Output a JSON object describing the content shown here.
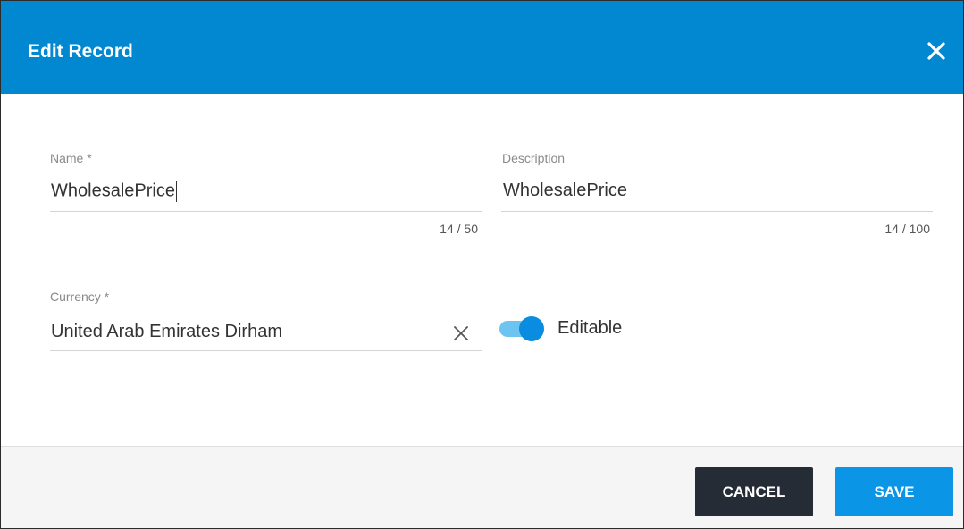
{
  "dialog": {
    "title": "Edit Record"
  },
  "fields": {
    "name": {
      "label": "Name *",
      "value": "WholesalePrice",
      "counter": "14 / 50"
    },
    "description": {
      "label": "Description",
      "value": "WholesalePrice",
      "counter": "14 / 100"
    },
    "currency": {
      "label": "Currency *",
      "value": "United Arab Emirates Dirham"
    },
    "editable": {
      "label": "Editable",
      "checked": true
    }
  },
  "footer": {
    "cancel_label": "CANCEL",
    "save_label": "SAVE"
  },
  "colors": {
    "header": "#0288d1",
    "save_button": "#0b95e6",
    "cancel_button": "#262c36",
    "toggle_track": "#6ec4f0",
    "toggle_knob": "#0a8de0"
  },
  "icons": {
    "close": "close-icon",
    "clear": "clear-icon"
  }
}
